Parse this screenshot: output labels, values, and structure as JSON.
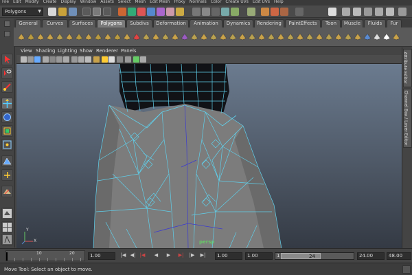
{
  "menubar": {
    "items": [
      "File",
      "Edit",
      "Modify",
      "Create",
      "Display",
      "Window",
      "Assets",
      "Select",
      "Mesh",
      "Edit Mesh",
      "Proxy",
      "Normals",
      "Color",
      "Create UVs",
      "Edit UVs",
      "Help"
    ]
  },
  "statusline": {
    "mode": "Polygons"
  },
  "shelf": {
    "tabs": [
      "General",
      "Curves",
      "Surfaces",
      "Polygons",
      "Subdivs",
      "Deformation",
      "Animation",
      "Dynamics",
      "Rendering",
      "PaintEffects",
      "Toon",
      "Muscle",
      "Fluids",
      "Fur"
    ],
    "active_tab": "Polygons"
  },
  "panel": {
    "menus": [
      "View",
      "Shading",
      "Lighting",
      "Show",
      "Renderer",
      "Panels"
    ],
    "camera_label": "persp"
  },
  "right_dock": {
    "tabs": [
      "Attribute Editor",
      "Channel Box / Layer Editor"
    ]
  },
  "timeline": {
    "ruler_numbers": [
      "10",
      "20"
    ],
    "current_frame": "1.00",
    "range_start": "1.00",
    "playback_start": "1.00",
    "slider_start": "1",
    "slider_end": "24",
    "playback_end": "24.00",
    "range_end": "48.00"
  },
  "help_line": {
    "text": "Move Tool: Select an object to move."
  },
  "axis": {
    "y": "Y",
    "x": "X"
  }
}
